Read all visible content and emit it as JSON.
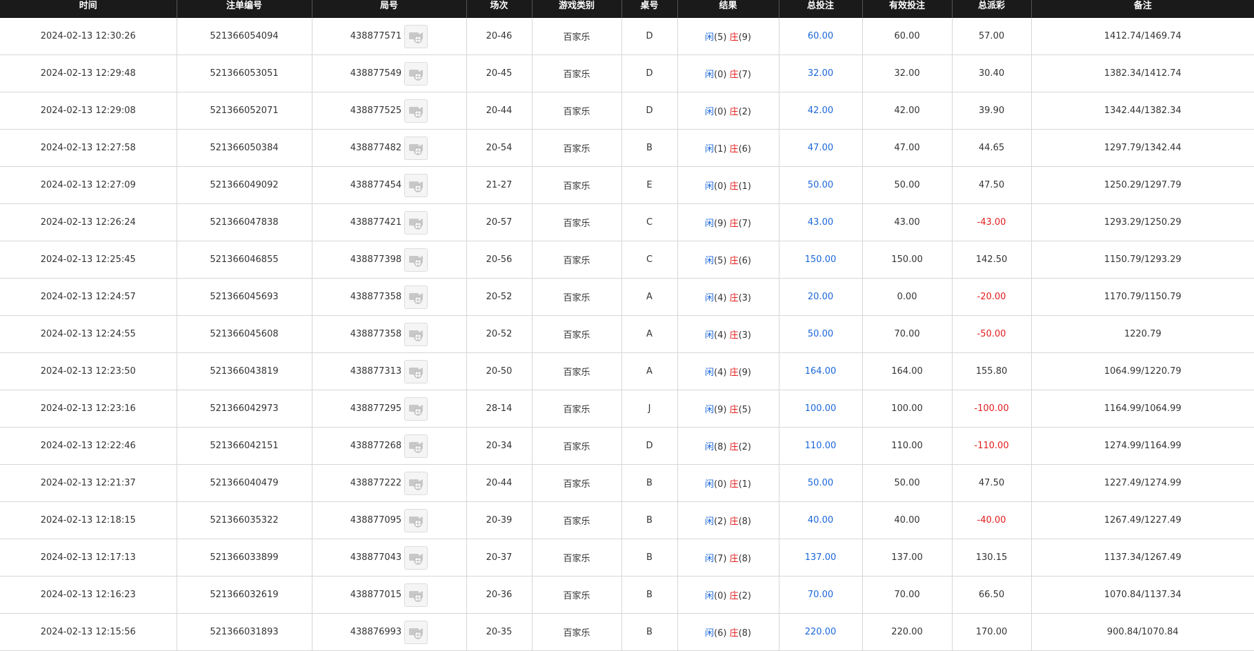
{
  "colors": {
    "header_bg": "#1a1a1a",
    "header_text": "#ffffff",
    "player": "#1a66d9",
    "banker": "#e21b1b",
    "bet_total": "#1a66d9",
    "negative": "#e21b1b"
  },
  "icons": {
    "replay": "video-replay-icon"
  },
  "table": {
    "headers": [
      "时间",
      "注单编号",
      "局号",
      "场次",
      "游戏类别",
      "桌号",
      "结果",
      "总投注",
      "有效投注",
      "总派彩",
      "备注"
    ],
    "rows": [
      {
        "time": "2024-02-13 12:30:26",
        "bet_id": "521366054094",
        "round_id": "438877571",
        "session": "20-46",
        "game": "百家乐",
        "table": "D",
        "player_label": "闲",
        "player_score": "(5)",
        "banker_label": "庄",
        "banker_score": "(9)",
        "total_bet": "60.00",
        "valid_bet": "60.00",
        "payout": "57.00",
        "note": "1412.74/1469.74"
      },
      {
        "time": "2024-02-13 12:29:48",
        "bet_id": "521366053051",
        "round_id": "438877549",
        "session": "20-45",
        "game": "百家乐",
        "table": "D",
        "player_label": "闲",
        "player_score": "(0)",
        "banker_label": "庄",
        "banker_score": "(7)",
        "total_bet": "32.00",
        "valid_bet": "32.00",
        "payout": "30.40",
        "note": "1382.34/1412.74"
      },
      {
        "time": "2024-02-13 12:29:08",
        "bet_id": "521366052071",
        "round_id": "438877525",
        "session": "20-44",
        "game": "百家乐",
        "table": "D",
        "player_label": "闲",
        "player_score": "(0)",
        "banker_label": "庄",
        "banker_score": "(2)",
        "total_bet": "42.00",
        "valid_bet": "42.00",
        "payout": "39.90",
        "note": "1342.44/1382.34"
      },
      {
        "time": "2024-02-13 12:27:58",
        "bet_id": "521366050384",
        "round_id": "438877482",
        "session": "20-54",
        "game": "百家乐",
        "table": "B",
        "player_label": "闲",
        "player_score": "(1)",
        "banker_label": "庄",
        "banker_score": "(6)",
        "total_bet": "47.00",
        "valid_bet": "47.00",
        "payout": "44.65",
        "note": "1297.79/1342.44"
      },
      {
        "time": "2024-02-13 12:27:09",
        "bet_id": "521366049092",
        "round_id": "438877454",
        "session": "21-27",
        "game": "百家乐",
        "table": "E",
        "player_label": "闲",
        "player_score": "(0)",
        "banker_label": "庄",
        "banker_score": "(1)",
        "total_bet": "50.00",
        "valid_bet": "50.00",
        "payout": "47.50",
        "note": "1250.29/1297.79"
      },
      {
        "time": "2024-02-13 12:26:24",
        "bet_id": "521366047838",
        "round_id": "438877421",
        "session": "20-57",
        "game": "百家乐",
        "table": "C",
        "player_label": "闲",
        "player_score": "(9)",
        "banker_label": "庄",
        "banker_score": "(7)",
        "total_bet": "43.00",
        "valid_bet": "43.00",
        "payout": "-43.00",
        "note": "1293.29/1250.29"
      },
      {
        "time": "2024-02-13 12:25:45",
        "bet_id": "521366046855",
        "round_id": "438877398",
        "session": "20-56",
        "game": "百家乐",
        "table": "C",
        "player_label": "闲",
        "player_score": "(5)",
        "banker_label": "庄",
        "banker_score": "(6)",
        "total_bet": "150.00",
        "valid_bet": "150.00",
        "payout": "142.50",
        "note": "1150.79/1293.29"
      },
      {
        "time": "2024-02-13 12:24:57",
        "bet_id": "521366045693",
        "round_id": "438877358",
        "session": "20-52",
        "game": "百家乐",
        "table": "A",
        "player_label": "闲",
        "player_score": "(4)",
        "banker_label": "庄",
        "banker_score": "(3)",
        "total_bet": "20.00",
        "valid_bet": "0.00",
        "payout": "-20.00",
        "note": "1170.79/1150.79"
      },
      {
        "time": "2024-02-13 12:24:55",
        "bet_id": "521366045608",
        "round_id": "438877358",
        "session": "20-52",
        "game": "百家乐",
        "table": "A",
        "player_label": "闲",
        "player_score": "(4)",
        "banker_label": "庄",
        "banker_score": "(3)",
        "total_bet": "50.00",
        "valid_bet": "70.00",
        "payout": "-50.00",
        "note": "1220.79"
      },
      {
        "time": "2024-02-13 12:23:50",
        "bet_id": "521366043819",
        "round_id": "438877313",
        "session": "20-50",
        "game": "百家乐",
        "table": "A",
        "player_label": "闲",
        "player_score": "(4)",
        "banker_label": "庄",
        "banker_score": "(9)",
        "total_bet": "164.00",
        "valid_bet": "164.00",
        "payout": "155.80",
        "note": "1064.99/1220.79"
      },
      {
        "time": "2024-02-13 12:23:16",
        "bet_id": "521366042973",
        "round_id": "438877295",
        "session": "28-14",
        "game": "百家乐",
        "table": "J",
        "player_label": "闲",
        "player_score": "(9)",
        "banker_label": "庄",
        "banker_score": "(5)",
        "total_bet": "100.00",
        "valid_bet": "100.00",
        "payout": "-100.00",
        "note": "1164.99/1064.99"
      },
      {
        "time": "2024-02-13 12:22:46",
        "bet_id": "521366042151",
        "round_id": "438877268",
        "session": "20-34",
        "game": "百家乐",
        "table": "D",
        "player_label": "闲",
        "player_score": "(8)",
        "banker_label": "庄",
        "banker_score": "(2)",
        "total_bet": "110.00",
        "valid_bet": "110.00",
        "payout": "-110.00",
        "note": "1274.99/1164.99"
      },
      {
        "time": "2024-02-13 12:21:37",
        "bet_id": "521366040479",
        "round_id": "438877222",
        "session": "20-44",
        "game": "百家乐",
        "table": "B",
        "player_label": "闲",
        "player_score": "(0)",
        "banker_label": "庄",
        "banker_score": "(1)",
        "total_bet": "50.00",
        "valid_bet": "50.00",
        "payout": "47.50",
        "note": "1227.49/1274.99"
      },
      {
        "time": "2024-02-13 12:18:15",
        "bet_id": "521366035322",
        "round_id": "438877095",
        "session": "20-39",
        "game": "百家乐",
        "table": "B",
        "player_label": "闲",
        "player_score": "(2)",
        "banker_label": "庄",
        "banker_score": "(8)",
        "total_bet": "40.00",
        "valid_bet": "40.00",
        "payout": "-40.00",
        "note": "1267.49/1227.49"
      },
      {
        "time": "2024-02-13 12:17:13",
        "bet_id": "521366033899",
        "round_id": "438877043",
        "session": "20-37",
        "game": "百家乐",
        "table": "B",
        "player_label": "闲",
        "player_score": "(7)",
        "banker_label": "庄",
        "banker_score": "(8)",
        "total_bet": "137.00",
        "valid_bet": "137.00",
        "payout": "130.15",
        "note": "1137.34/1267.49"
      },
      {
        "time": "2024-02-13 12:16:23",
        "bet_id": "521366032619",
        "round_id": "438877015",
        "session": "20-36",
        "game": "百家乐",
        "table": "B",
        "player_label": "闲",
        "player_score": "(0)",
        "banker_label": "庄",
        "banker_score": "(2)",
        "total_bet": "70.00",
        "valid_bet": "70.00",
        "payout": "66.50",
        "note": "1070.84/1137.34"
      },
      {
        "time": "2024-02-13 12:15:56",
        "bet_id": "521366031893",
        "round_id": "438876993",
        "session": "20-35",
        "game": "百家乐",
        "table": "B",
        "player_label": "闲",
        "player_score": "(6)",
        "banker_label": "庄",
        "banker_score": "(8)",
        "total_bet": "220.00",
        "valid_bet": "220.00",
        "payout": "170.00",
        "note": "900.84/1070.84"
      }
    ]
  }
}
